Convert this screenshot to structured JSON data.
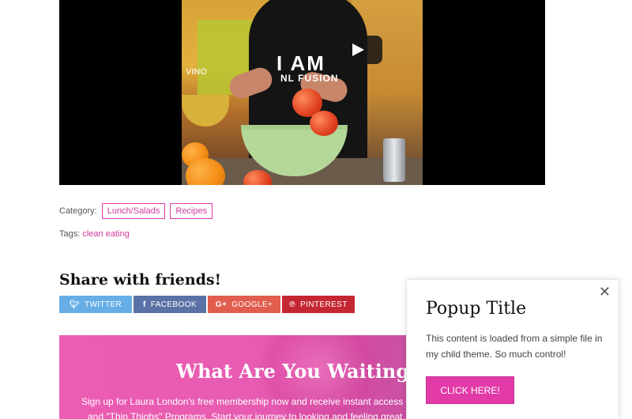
{
  "video": {
    "shirt_text": "I AM",
    "shirt_subtext": "NL FUSION",
    "label_text": "VINO",
    "play_icon": "play-icon"
  },
  "meta": {
    "category_label": "Category:",
    "categories": [
      "Lunch/Salads",
      "Recipes"
    ],
    "tags_label": "Tags:",
    "tags": [
      "clean eating"
    ]
  },
  "share": {
    "title": "Share with friends!",
    "buttons": [
      {
        "label": "TWITTER",
        "icon": "twitter-icon",
        "color": "#67aee6"
      },
      {
        "label": "FACEBOOK",
        "icon": "facebook-icon",
        "color": "#5b72a7"
      },
      {
        "label": "GOOGLE+",
        "icon": "google-plus-icon",
        "color": "#e15d4d"
      },
      {
        "label": "PINTEREST",
        "icon": "pinterest-icon",
        "color": "#c52732"
      }
    ]
  },
  "banner": {
    "heading": "What Are You Waiting Fo",
    "text_line1": "Sign up for Laura London's free membership now and receive instant access",
    "text_line2": "and \"Thin Thighs\" Programs. Start your journey to looking and feeling great"
  },
  "popup": {
    "close": "✕",
    "title": "Popup Title",
    "body": "This content is loaded from a simple file in my child theme. So much control!",
    "cta": "CLICK HERE!"
  },
  "colors": {
    "accent": "#e23ba8",
    "banner": "#e65bb1"
  }
}
